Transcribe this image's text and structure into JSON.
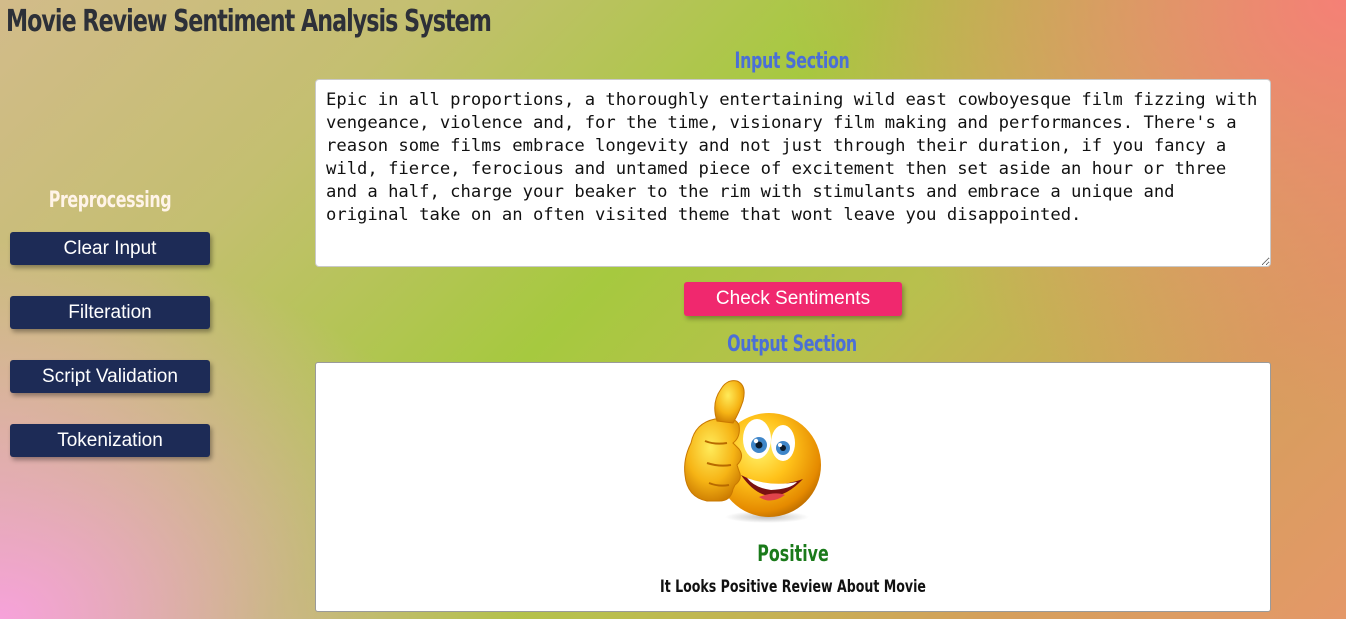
{
  "app": {
    "title": "Movie Review Sentiment Analysis System"
  },
  "sidebar": {
    "heading": "Preprocessing",
    "buttons": [
      {
        "label": "Clear Input"
      },
      {
        "label": "Filteration"
      },
      {
        "label": "Script Validation"
      },
      {
        "label": "Tokenization"
      }
    ]
  },
  "input_section": {
    "heading": "Input Section",
    "review_text": "Epic in all proportions, a thoroughly entertaining wild east cowboyesque film fizzing with vengeance, violence and, for the time, visionary film making and performances. There's a reason some films embrace longevity and not just through their duration, if you fancy a wild, fierce, ferocious and untamed piece of excitement then set aside an hour or three and a half, charge your beaker to the rim with stimulants and embrace a unique and original take on an often visited theme that wont leave you disappointed.",
    "check_button_label": "Check Sentiments"
  },
  "output_section": {
    "heading": "Output Section",
    "sentiment": "Positive",
    "message": "It Looks Positive Review About Movie",
    "icon": "thumbs-up-emoji-icon"
  },
  "colors": {
    "sidebar_button": "#1d2b56",
    "check_button": "#f0286e",
    "section_heading": "#4b6fd6",
    "positive_label": "#1a7a1a"
  }
}
